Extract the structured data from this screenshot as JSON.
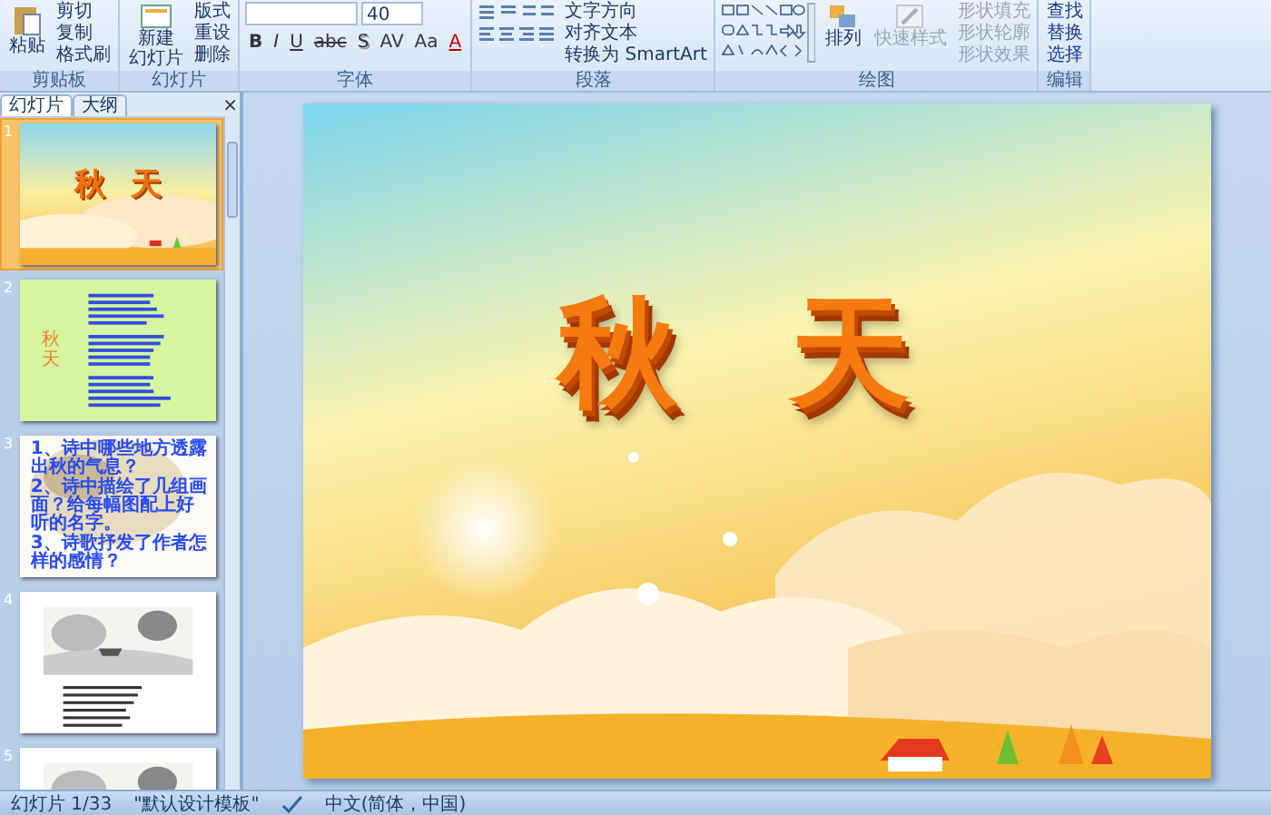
{
  "ribbon": {
    "clipboard": {
      "label": "剪贴板",
      "paste": "粘贴",
      "items": [
        "剪切",
        "复制",
        "格式刷"
      ]
    },
    "slides_group": {
      "label": "幻灯片",
      "new_slide": [
        "新建",
        "幻灯片"
      ],
      "items": [
        "版式",
        "重设",
        "删除"
      ]
    },
    "font": {
      "label": "字体",
      "size": "40",
      "buttons": [
        "B",
        "I",
        "U",
        "abc",
        "S",
        "AV",
        "Aa",
        "A"
      ]
    },
    "paragraph": {
      "label": "段落",
      "items": [
        "文字方向",
        "对齐文本",
        "转换为 SmartArt"
      ]
    },
    "drawing": {
      "label": "绘图",
      "arrange": "排列",
      "quick_styles": "快速样式",
      "items": [
        {
          "label": "形状填充",
          "disabled": true
        },
        {
          "label": "形状轮廓",
          "disabled": true
        },
        {
          "label": "形状效果",
          "disabled": true
        }
      ]
    },
    "editing": {
      "label": "编辑",
      "items": [
        "查找",
        "替换",
        "选择"
      ]
    }
  },
  "pane": {
    "tabs": [
      {
        "label": "幻灯片",
        "selected": true
      },
      {
        "label": "大纲",
        "selected": false
      }
    ],
    "close": "×",
    "thumbnails": [
      {
        "number": "1",
        "kind": "title",
        "selected": true,
        "title": "秋天"
      },
      {
        "number": "2",
        "kind": "poem",
        "selected": false,
        "title": "秋天"
      },
      {
        "number": "3",
        "kind": "questions",
        "selected": false,
        "lines": [
          "1、诗中哪些地方透露出秋的气息？",
          "2、诗中描绘了几组画面？给每幅图配上好听的名字。",
          "3、诗歌抒发了作者怎样的感情？"
        ]
      },
      {
        "number": "4",
        "kind": "sketch",
        "selected": false
      },
      {
        "number": "5",
        "kind": "sketch_partial",
        "selected": false
      }
    ]
  },
  "slide": {
    "title": "秋天"
  },
  "status_bar": {
    "slide": "幻灯片 1/33",
    "theme": "\"默认设计模板\"",
    "language": "中文(简体，中国)"
  }
}
